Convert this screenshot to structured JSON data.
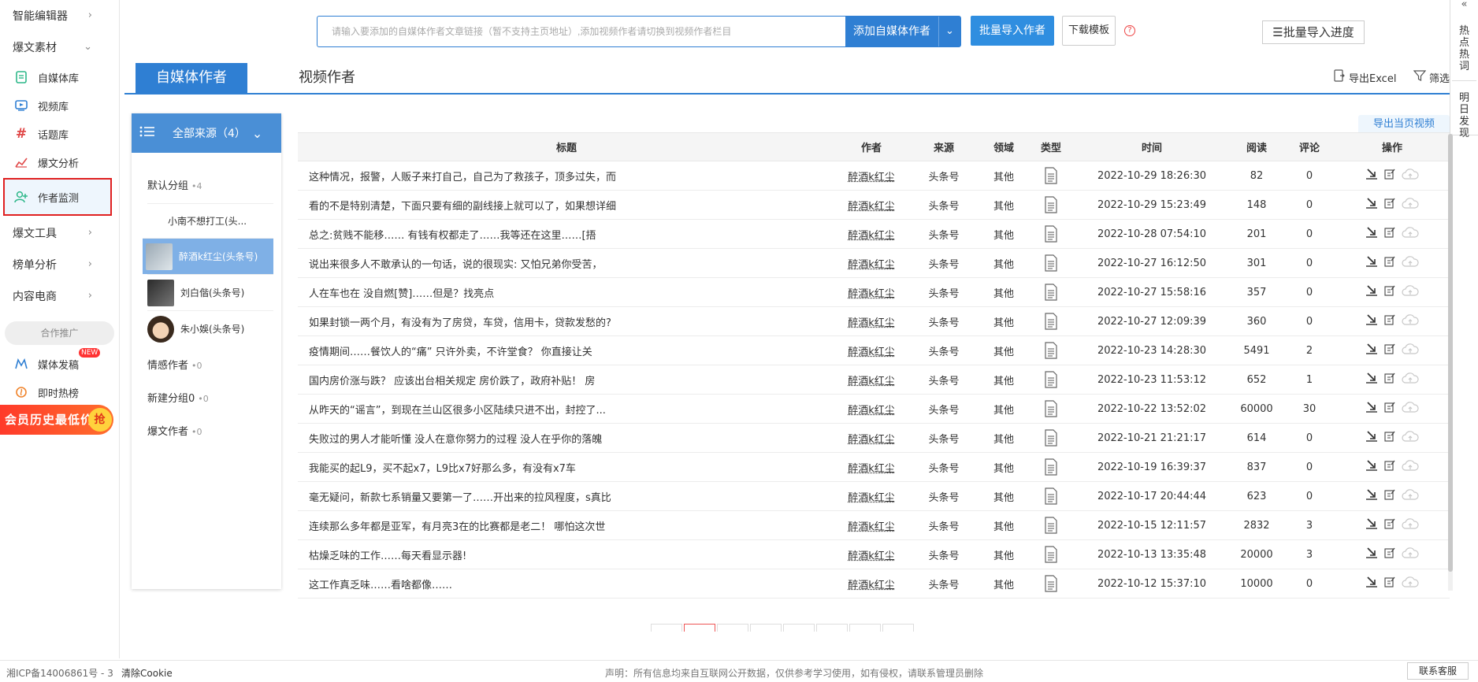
{
  "sidebar": {
    "group_smart_editor": "智能编辑器",
    "group_hot_material": "爆文素材",
    "items": [
      {
        "label": "自媒体库"
      },
      {
        "label": "视频库"
      },
      {
        "label": "话题库"
      },
      {
        "label": "爆文分析"
      },
      {
        "label": "作者监测"
      }
    ],
    "group_tools": "爆文工具",
    "group_rank": "榜单分析",
    "group_ecommerce": "内容电商",
    "promo_label": "合作推广",
    "media_publish": "媒体发稿",
    "new_badge": "NEW",
    "instant_hot": "即时热榜",
    "vip_banner": "会员历史最低价",
    "vip_grab": "抢"
  },
  "topbar": {
    "search_placeholder": "请输入要添加的自媒体作者文章链接（暂不支持主页地址）,添加视频作者请切换到视频作者栏目",
    "add_author": "添加自媒体作者",
    "bulk_import": "批量导入作者",
    "download_template": "下载模板",
    "help": "?",
    "bulk_progress": "☰批量导入进度"
  },
  "right_rail": {
    "collapse": "«",
    "hot_words": "热点热词",
    "tomorrow": "明日发现"
  },
  "tabs": {
    "media_author": "自媒体作者",
    "video_author": "视频作者",
    "export_excel": "导出Excel",
    "filter": "筛选"
  },
  "groups": {
    "all_sources": "全部来源（4）",
    "default_group": "默认分组",
    "default_count": "•4",
    "sub_authors": [
      {
        "name": "小南不想打工(头..."
      },
      {
        "name": "醉酒k红尘(头条号)"
      },
      {
        "name": "刘白偕(头条号)"
      },
      {
        "name": "朱小娛(头条号)"
      }
    ],
    "emotion": "情感作者",
    "emotion_count": "•0",
    "new_group": "新建分组0",
    "new_group_count": "•0",
    "hot_author": "爆文作者",
    "hot_author_count": "•0"
  },
  "table": {
    "export_page_video": "导出当页视频",
    "headers": [
      "标题",
      "作者",
      "来源",
      "领域",
      "类型",
      "时间",
      "阅读",
      "评论",
      "操作"
    ],
    "rows": [
      {
        "title": "这种情况，报警，人贩子来打自己，自己为了救孩子，顶多过失，而",
        "author": "醉酒k红尘",
        "source": "头条号",
        "field": "其他",
        "time": "2022-10-29 18:26:30",
        "reads": "82",
        "comments": "0"
      },
      {
        "title": "看的不是特别清楚，下面只要有细的副线接上就可以了，如果想详细",
        "author": "醉酒k红尘",
        "source": "头条号",
        "field": "其他",
        "time": "2022-10-29 15:23:49",
        "reads": "148",
        "comments": "0"
      },
      {
        "title": "总之:贫贱不能移…… 有钱有权都走了……我等还在这里……[捂",
        "author": "醉酒k红尘",
        "source": "头条号",
        "field": "其他",
        "time": "2022-10-28 07:54:10",
        "reads": "201",
        "comments": "0"
      },
      {
        "title": "说出来很多人不敢承认的一句话，说的很现实: 又怕兄弟你受苦，",
        "author": "醉酒k红尘",
        "source": "头条号",
        "field": "其他",
        "time": "2022-10-27 16:12:50",
        "reads": "301",
        "comments": "0"
      },
      {
        "title": "人在车也在 没自燃[赞]……但是？找亮点",
        "author": "醉酒k红尘",
        "source": "头条号",
        "field": "其他",
        "time": "2022-10-27 15:58:16",
        "reads": "357",
        "comments": "0"
      },
      {
        "title": "如果封锁一两个月，有没有为了房贷，车贷，信用卡，贷款发愁的?",
        "author": "醉酒k红尘",
        "source": "头条号",
        "field": "其他",
        "time": "2022-10-27 12:09:39",
        "reads": "360",
        "comments": "0"
      },
      {
        "title": "疫情期间……餐饮人的“痛” 只许外卖，不许堂食？ 你直接让关",
        "author": "醉酒k红尘",
        "source": "头条号",
        "field": "其他",
        "time": "2022-10-23 14:28:30",
        "reads": "5491",
        "comments": "2"
      },
      {
        "title": "国内房价涨与跌？ 应该出台相关规定 房价跌了，政府补贴！ 房",
        "author": "醉酒k红尘",
        "source": "头条号",
        "field": "其他",
        "time": "2022-10-23 11:53:12",
        "reads": "652",
        "comments": "1"
      },
      {
        "title": "从昨天的“谣言”，到现在兰山区很多小区陆续只进不出，封控了...",
        "author": "醉酒k红尘",
        "source": "头条号",
        "field": "其他",
        "time": "2022-10-22 13:52:02",
        "reads": "60000",
        "comments": "30"
      },
      {
        "title": "失败过的男人才能听懂 没人在意你努力的过程 没人在乎你的落魄",
        "author": "醉酒k红尘",
        "source": "头条号",
        "field": "其他",
        "time": "2022-10-21 21:21:17",
        "reads": "614",
        "comments": "0"
      },
      {
        "title": "我能买的起L9，买不起x7，L9比x7好那么多，有没有x7车",
        "author": "醉酒k红尘",
        "source": "头条号",
        "field": "其他",
        "time": "2022-10-19 16:39:37",
        "reads": "837",
        "comments": "0"
      },
      {
        "title": "毫无疑问，新款七系销量又要第一了……开出来的拉风程度，s真比",
        "author": "醉酒k红尘",
        "source": "头条号",
        "field": "其他",
        "time": "2022-10-17 20:44:44",
        "reads": "623",
        "comments": "0"
      },
      {
        "title": "连续那么多年都是亚军，有月亮3在的比赛都是老二！ 哪怕这次世",
        "author": "醉酒k红尘",
        "source": "头条号",
        "field": "其他",
        "time": "2022-10-15 12:11:57",
        "reads": "2832",
        "comments": "3"
      },
      {
        "title": "枯燥乏味的工作……每天看显示器!",
        "author": "醉酒k红尘",
        "source": "头条号",
        "field": "其他",
        "time": "2022-10-13 13:35:48",
        "reads": "20000",
        "comments": "3"
      },
      {
        "title": "这工作真乏味……看啥都像……",
        "author": "醉酒k红尘",
        "source": "头条号",
        "field": "其他",
        "time": "2022-10-12 15:37:10",
        "reads": "10000",
        "comments": "0"
      }
    ]
  },
  "footer": {
    "icp": "湘ICP备14006861号 - 3",
    "clear_cookie": "清除Cookie",
    "notice": "声明：所有信息均来自互联网公开数据，仅供参考学习使用，如有侵权，请联系管理员删除",
    "contact": "联系客服"
  },
  "colors": {
    "brand_blue": "#2f7fd3",
    "highlight_red": "#e02020"
  }
}
